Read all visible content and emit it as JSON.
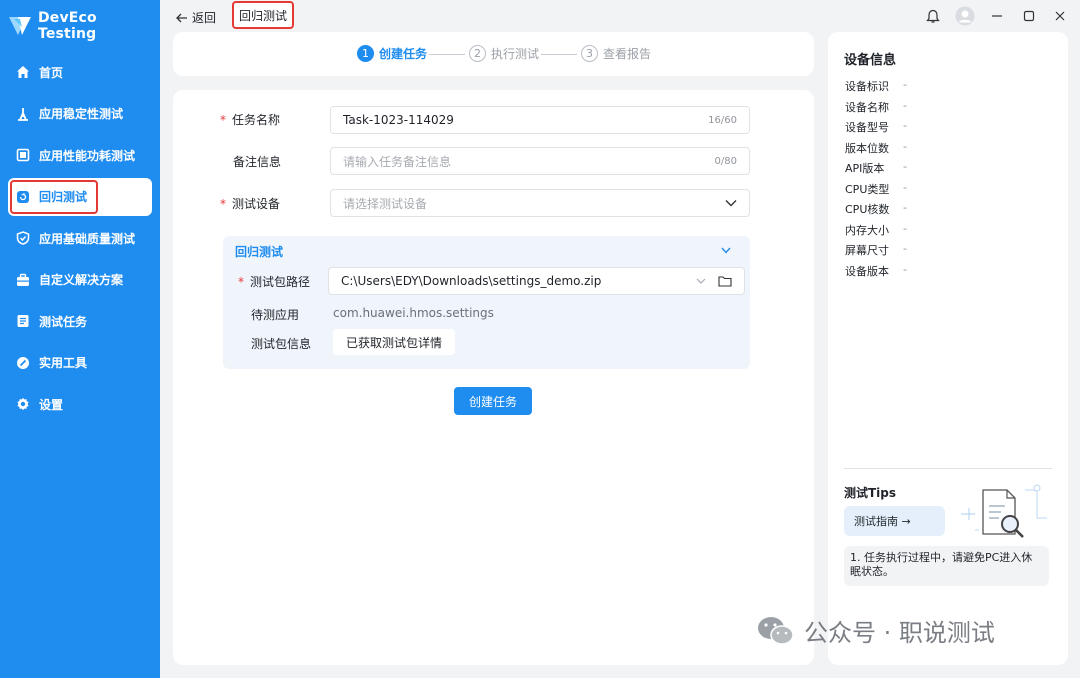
{
  "app": {
    "name": "DevEco Testing"
  },
  "sidebar": {
    "items": [
      {
        "label": "首页",
        "icon": "home-icon"
      },
      {
        "label": "应用稳定性测试",
        "icon": "stability-icon"
      },
      {
        "label": "应用性能功耗测试",
        "icon": "performance-icon"
      },
      {
        "label": "回归测试",
        "icon": "regression-icon",
        "active": true
      },
      {
        "label": "应用基础质量测试",
        "icon": "quality-icon"
      },
      {
        "label": "自定义解决方案",
        "icon": "toolbox-icon"
      },
      {
        "label": "测试任务",
        "icon": "task-list-icon"
      },
      {
        "label": "实用工具",
        "icon": "tools-icon"
      },
      {
        "label": "设置",
        "icon": "gear-icon"
      }
    ]
  },
  "topbar": {
    "back_label": "返回",
    "breadcrumb": "回归测试"
  },
  "stepper": {
    "steps": [
      {
        "num": "1",
        "label": "创建任务",
        "active": true
      },
      {
        "num": "2",
        "label": "执行测试",
        "active": false
      },
      {
        "num": "3",
        "label": "查看报告",
        "active": false
      }
    ]
  },
  "form": {
    "task_name": {
      "label": "任务名称",
      "value": "Task-1023-114029",
      "count": "16/60",
      "required": true
    },
    "remark": {
      "label": "备注信息",
      "placeholder": "请输入任务备注信息",
      "count": "0/80",
      "required": false
    },
    "device": {
      "label": "测试设备",
      "placeholder": "请选择测试设备",
      "required": true
    },
    "panel": {
      "title": "回归测试",
      "package_path": {
        "label": "测试包路径",
        "value": "C:\\Users\\EDY\\Downloads\\settings_demo.zip",
        "required": true
      },
      "app_under_test": {
        "label": "待测应用",
        "value": "com.huawei.hmos.settings"
      },
      "package_info": {
        "label": "测试包信息",
        "value": "已获取测试包详情"
      }
    },
    "submit_label": "创建任务"
  },
  "device_info": {
    "title": "设备信息",
    "rows": [
      {
        "key": "设备标识",
        "value": "-"
      },
      {
        "key": "设备名称",
        "value": "-"
      },
      {
        "key": "设备型号",
        "value": "-"
      },
      {
        "key": "版本位数",
        "value": "-"
      },
      {
        "key": "API版本",
        "value": "-"
      },
      {
        "key": "CPU类型",
        "value": "-"
      },
      {
        "key": "CPU核数",
        "value": "-"
      },
      {
        "key": "内存大小",
        "value": "-"
      },
      {
        "key": "屏幕尺寸",
        "value": "-"
      },
      {
        "key": "设备版本",
        "value": "-"
      }
    ]
  },
  "tips": {
    "title": "测试Tips",
    "guide_label": "测试指南 →",
    "items": [
      "1. 任务执行过程中，请避免PC进入休眠状态。"
    ]
  },
  "watermark": "公众号 · 职说测试",
  "colors": {
    "primary": "#1f8cf0",
    "highlight": "#e53935"
  }
}
